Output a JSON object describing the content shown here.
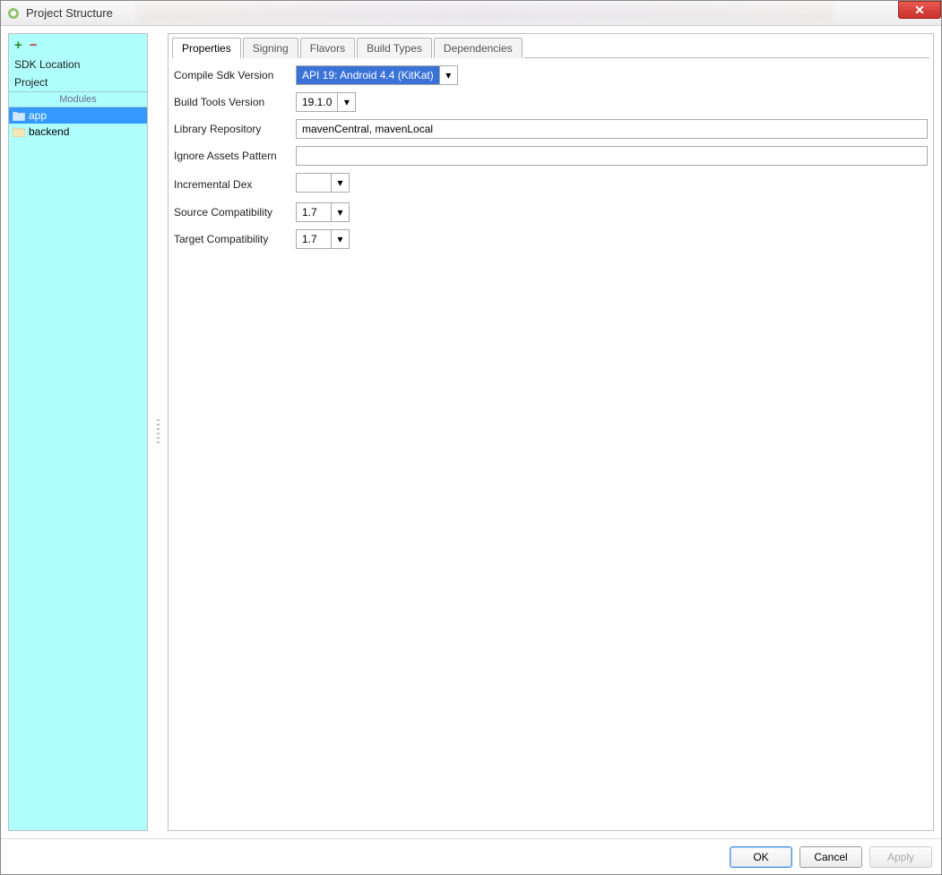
{
  "window": {
    "title": "Project Structure"
  },
  "sidebar": {
    "items": [
      {
        "label": "SDK Location"
      },
      {
        "label": "Project"
      }
    ],
    "section_label": "Modules",
    "modules": [
      {
        "label": "app",
        "selected": true
      },
      {
        "label": "backend",
        "selected": false
      }
    ]
  },
  "tabs": [
    {
      "label": "Properties",
      "active": true
    },
    {
      "label": "Signing",
      "active": false
    },
    {
      "label": "Flavors",
      "active": false
    },
    {
      "label": "Build Types",
      "active": false
    },
    {
      "label": "Dependencies",
      "active": false
    }
  ],
  "form": {
    "compile_sdk_label": "Compile Sdk Version",
    "compile_sdk_value": "API 19: Android 4.4 (KitKat)",
    "build_tools_label": "Build Tools Version",
    "build_tools_value": "19.1.0",
    "library_repo_label": "Library Repository",
    "library_repo_value": "mavenCentral, mavenLocal",
    "ignore_assets_label": "Ignore Assets Pattern",
    "ignore_assets_value": "",
    "incremental_dex_label": "Incremental Dex",
    "incremental_dex_value": "",
    "source_compat_label": "Source Compatibility",
    "source_compat_value": "1.7",
    "target_compat_label": "Target Compatibility",
    "target_compat_value": "1.7"
  },
  "footer": {
    "ok": "OK",
    "cancel": "Cancel",
    "apply": "Apply"
  }
}
